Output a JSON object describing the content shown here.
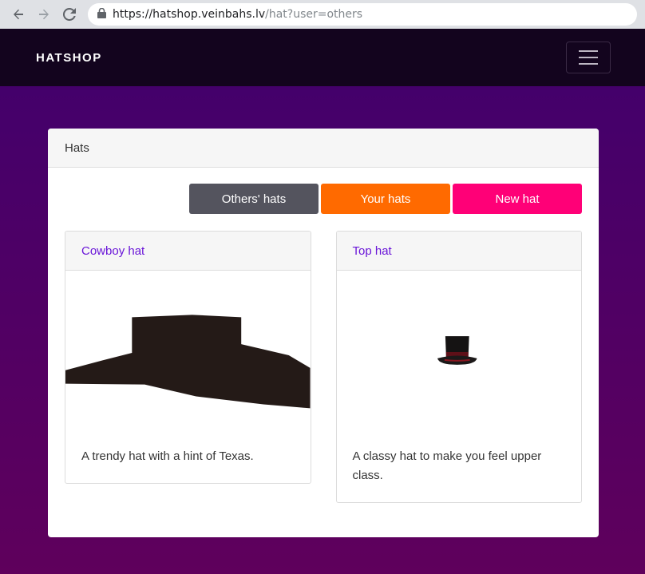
{
  "browser": {
    "url_host": "https://hatshop.veinbahs.lv",
    "url_path": "/hat?user=others"
  },
  "navbar": {
    "brand": "HATSHOP"
  },
  "panel": {
    "title": "Hats",
    "buttons": {
      "others": "Others' hats",
      "yours": "Your hats",
      "new": "New hat"
    }
  },
  "hats": [
    {
      "name": "Cowboy hat",
      "description": "A trendy hat with a hint of Texas."
    },
    {
      "name": "Top hat",
      "description": "A classy hat to make you feel upper class."
    }
  ],
  "colors": {
    "navbar": "#13041e",
    "others_button": "#54545e",
    "yours_button": "#ff6a00",
    "new_button": "#ff0077",
    "link": "#6a16d8"
  }
}
